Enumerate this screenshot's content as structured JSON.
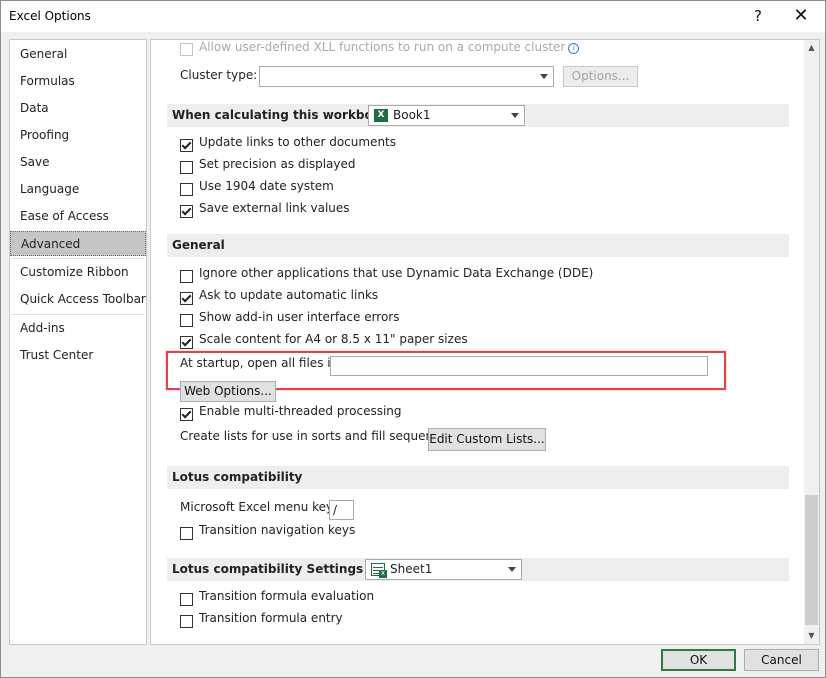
{
  "window": {
    "title": "Excel Options",
    "help_label": "?",
    "close_label": "✕"
  },
  "sidebar": {
    "items": [
      {
        "label": "General"
      },
      {
        "label": "Formulas"
      },
      {
        "label": "Data"
      },
      {
        "label": "Proofing"
      },
      {
        "label": "Save"
      },
      {
        "label": "Language"
      },
      {
        "label": "Ease of Access"
      },
      {
        "label": "Advanced",
        "active": true
      },
      {
        "label": "Customize Ribbon"
      },
      {
        "label": "Quick Access Toolbar"
      },
      {
        "label": "Add-ins"
      },
      {
        "label": "Trust Center"
      }
    ]
  },
  "top": {
    "xll_label": "Allow user-defined XLL functions to run on a compute cluster",
    "cluster_type_label": "Cluster type:",
    "cluster_type_value": "",
    "options_button": "Options..."
  },
  "workbook_section": {
    "title": "When calculating this workbook:",
    "workbook_value": "Book1",
    "items": [
      {
        "label": "Update links to other documents",
        "checked": true
      },
      {
        "label": "Set precision as displayed",
        "checked": false
      },
      {
        "label": "Use 1904 date system",
        "checked": false
      },
      {
        "label": "Save external link values",
        "checked": true
      }
    ]
  },
  "general_section": {
    "title": "General",
    "items": [
      {
        "label": "Ignore other applications that use Dynamic Data Exchange (DDE)",
        "checked": false
      },
      {
        "label": "Ask to update automatic links",
        "checked": true
      },
      {
        "label": "Show add-in user interface errors",
        "checked": false
      },
      {
        "label": "Scale content for A4 or 8.5 x 11\" paper sizes",
        "checked": true
      }
    ],
    "startup_label": "At startup, open all files in:",
    "startup_value": "",
    "web_options_button": "Web Options...",
    "multithreaded_label": "Enable multi-threaded processing",
    "multithreaded_checked": true,
    "custom_lists_label": "Create lists for use in sorts and fill sequences:",
    "custom_lists_button": "Edit Custom Lists..."
  },
  "lotus_section": {
    "title": "Lotus compatibility",
    "menu_key_label": "Microsoft Excel menu key:",
    "menu_key_value": "/",
    "transition_nav_label": "Transition navigation keys",
    "transition_nav_checked": false
  },
  "lotus_settings_section": {
    "title": "Lotus compatibility Settings for:",
    "sheet_value": "Sheet1",
    "items": [
      {
        "label": "Transition formula evaluation",
        "checked": false
      },
      {
        "label": "Transition formula entry",
        "checked": false
      }
    ]
  },
  "footer": {
    "ok_label": "OK",
    "cancel_label": "Cancel"
  },
  "colors": {
    "highlight": "#e0444c",
    "accent": "#2f7a3d"
  }
}
